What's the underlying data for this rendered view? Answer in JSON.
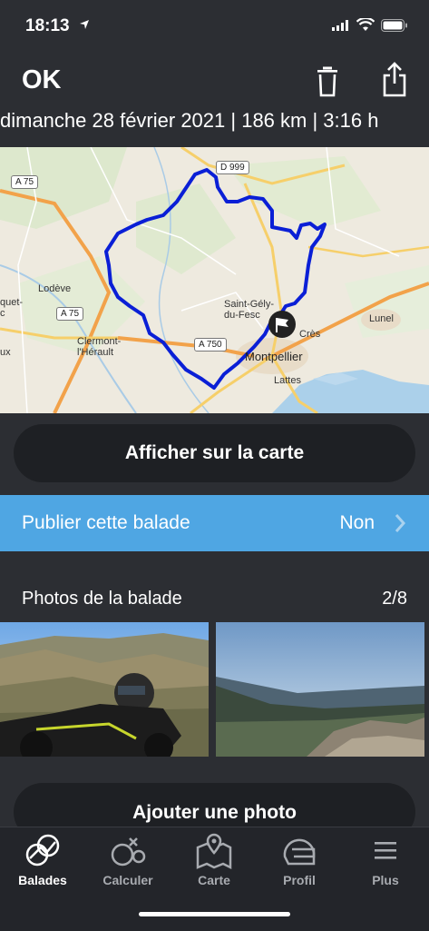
{
  "status": {
    "time": "18:13"
  },
  "header": {
    "title": "OK",
    "meta": "dimanche 28 février 2021 | 186 km | 3:16 h"
  },
  "map": {
    "roads": {
      "a75_top": "A 75",
      "d999": "D 999",
      "a75_mid": "A 75",
      "a750": "A 750"
    },
    "places": {
      "lodeve": "Lodève",
      "saint_gely": "Saint-Gély-\ndu-Fesc",
      "cres": "Crès",
      "lunel": "Lunel",
      "clermont": "Clermont-\nl'Hérault",
      "montpellier": "Montpellier",
      "lattes": "Lattes",
      "left1": "quet-\nc",
      "left2": "ux"
    }
  },
  "actions": {
    "show_on_map": "Afficher sur la carte",
    "publish_label": "Publier cette balade",
    "publish_value": "Non",
    "add_photo": "Ajouter une photo"
  },
  "photos": {
    "title": "Photos de la balade",
    "count": "2/8"
  },
  "tabbar": {
    "tabs": [
      {
        "label": "Balades",
        "icon": "rides-icon"
      },
      {
        "label": "Calculer",
        "icon": "calculate-route-icon"
      },
      {
        "label": "Carte",
        "icon": "map-icon"
      },
      {
        "label": "Profil",
        "icon": "helmet-icon"
      },
      {
        "label": "Plus",
        "icon": "menu-icon"
      }
    ]
  },
  "colors": {
    "accent": "#4fa6e3",
    "background": "#2c2e33",
    "route": "#0a1fd6"
  }
}
